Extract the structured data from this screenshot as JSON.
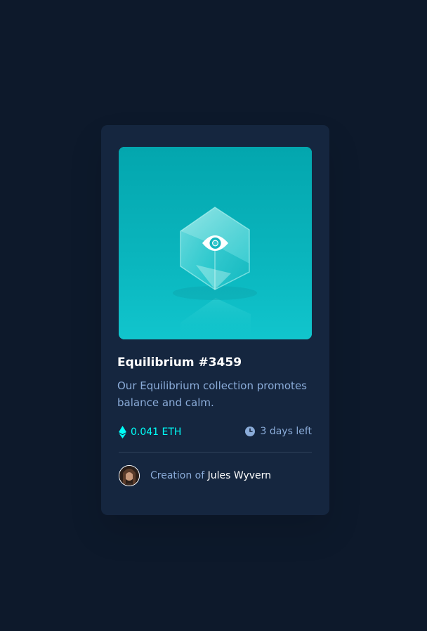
{
  "card": {
    "title": "Equilibrium #3459",
    "description": "Our Equilibrium collection promotes balance and calm.",
    "price": "0.041 ETH",
    "time_left": "3 days left",
    "creator_prefix": "Creation of",
    "creator_name": "Jules Wyvern"
  },
  "colors": {
    "page_background": "#0D192B",
    "card_background": "#15263F",
    "accent_cyan": "#00FFF8",
    "soft_blue": "#8BACD9",
    "white": "#FFFFFF",
    "divider": "#2E405A"
  },
  "icons": {
    "hero_overlay": "view-eye-icon",
    "price": "ethereum-icon",
    "time": "clock-icon"
  }
}
